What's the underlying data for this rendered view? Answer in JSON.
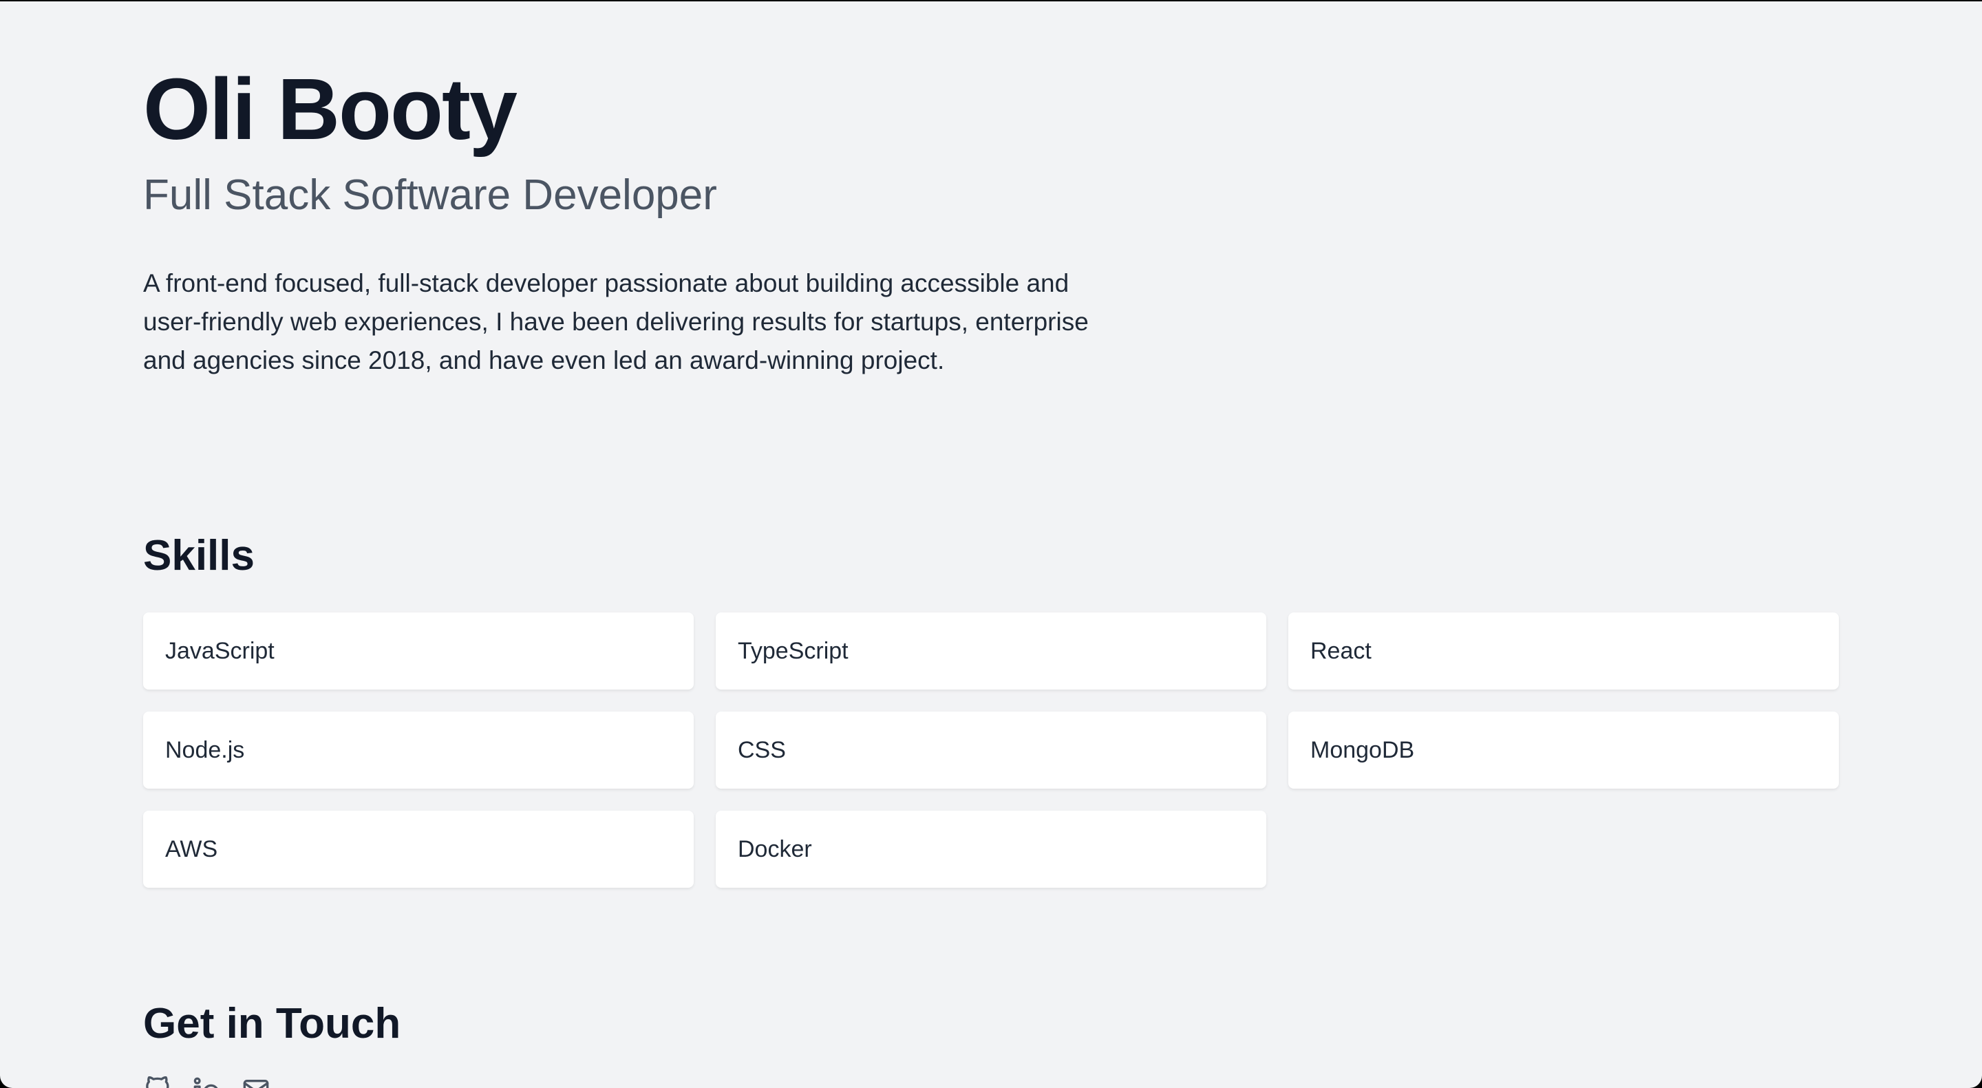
{
  "header": {
    "name": "Oli Booty",
    "role": "Full Stack Software Developer",
    "bio": "A front-end focused, full-stack developer passionate about building accessible and user-friendly web experiences, I have been delivering results for startups, enterprise and agencies since 2018, and have even led an award-winning project."
  },
  "skills": {
    "title": "Skills",
    "items": [
      {
        "label": "JavaScript"
      },
      {
        "label": "TypeScript"
      },
      {
        "label": "React"
      },
      {
        "label": "Node.js"
      },
      {
        "label": "CSS"
      },
      {
        "label": "MongoDB"
      },
      {
        "label": "AWS"
      },
      {
        "label": "Docker"
      }
    ]
  },
  "contact": {
    "title": "Get in Touch",
    "icons": [
      "github-icon",
      "linkedin-icon",
      "email-icon"
    ]
  },
  "colors": {
    "background": "#f2f3f5",
    "heading": "#111827",
    "subheading": "#4b5563",
    "body_text": "#1f2937",
    "card": "#ffffff"
  }
}
